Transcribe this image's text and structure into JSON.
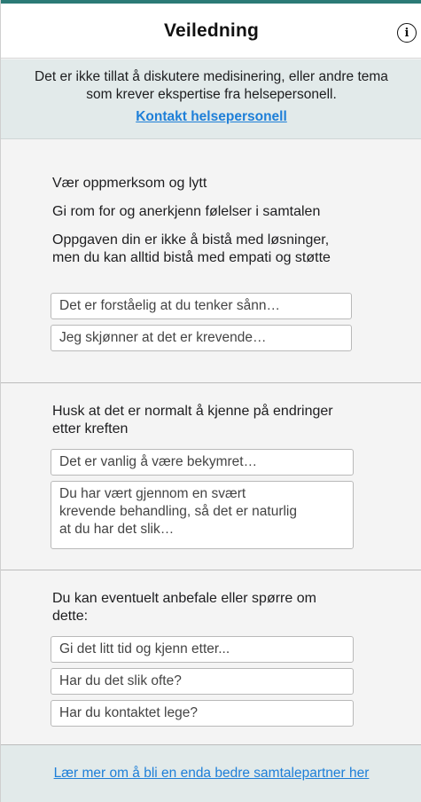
{
  "header": {
    "title": "Veiledning",
    "info_icon": "info-circle-icon",
    "info_glyph": "i"
  },
  "notice": {
    "line1": "Det er ikke tillat å diskutere medisinering, eller andre tema",
    "line2": "som krever ekspertise fra helsepersonell.",
    "link": "Kontakt helsepersonell"
  },
  "sections": [
    {
      "tips": [
        "Vær oppmerksom og lytt",
        "Gi rom for og anerkjenn følelser i samtalen",
        "Oppgaven din er ikke å bistå med løsninger,",
        "men du kan alltid bistå med empati og støtte"
      ],
      "suggestions": [
        "Det er forståelig at du tenker sånn…",
        "Jeg skjønner at det er krevende…"
      ]
    },
    {
      "tips": [
        "Husk at det er normalt å kjenne på endringer",
        "etter kreften"
      ],
      "suggestions": [
        "Det er vanlig å være bekymret…",
        "Du har vært gjennom en svært",
        "krevende behandling, så det er naturlig",
        "at du har det slik…"
      ]
    },
    {
      "tips": [
        "Du kan eventuelt anbefale eller spørre om",
        "dette:"
      ],
      "suggestions": [
        "Gi det litt tid og kjenn etter...",
        "Har du det slik ofte?",
        "Har du kontaktet lege?"
      ]
    }
  ],
  "footer": {
    "link": "Lær mer om å bli en enda bedre samtalepartner her"
  },
  "colors": {
    "accent": "#2c7a76",
    "link": "#1e7fd8",
    "notice_bg": "#e2eaea",
    "page_bg": "#f4f4f4"
  }
}
